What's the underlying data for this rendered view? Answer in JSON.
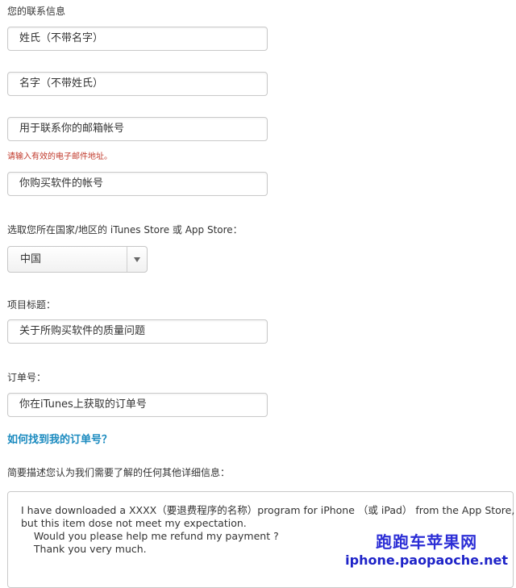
{
  "contact": {
    "section_title": "您的联系信息",
    "last_name_placeholder": "姓氏（不带名字）",
    "first_name_placeholder": "名字（不带姓氏）",
    "email_placeholder": "用于联系你的邮箱帐号",
    "email_error": "请输入有效的电子邮件地址。",
    "account_placeholder": "你购买软件的帐号"
  },
  "country": {
    "label": "选取您所在国家/地区的 iTunes Store 或 App Store：",
    "selected": "中国",
    "dropdown_icon": "triangle-down-icon"
  },
  "subject": {
    "label": "项目标题：",
    "value": "关于所购买软件的质量问题"
  },
  "order": {
    "label": "订单号：",
    "value": "你在iTunes上获取的订单号",
    "help_link": "如何找到我的订单号？"
  },
  "details": {
    "label": "简要描述您认为我们需要了解的任何其他详细信息：",
    "lines": [
      "I have downloaded a XXXX（要退费程序的名称）program for iPhone （或 iPad） from the App Store,",
      "but this item dose not meet my expectation.",
      "    Would you please help me refund my payment ?",
      "    Thank you very much."
    ]
  },
  "watermark": {
    "title": "跑跑车苹果网",
    "url": "iphone.paopaoche.net"
  },
  "colors": {
    "link": "#1a8abf",
    "error": "#c0392b",
    "watermark": "#2c2ed6"
  }
}
